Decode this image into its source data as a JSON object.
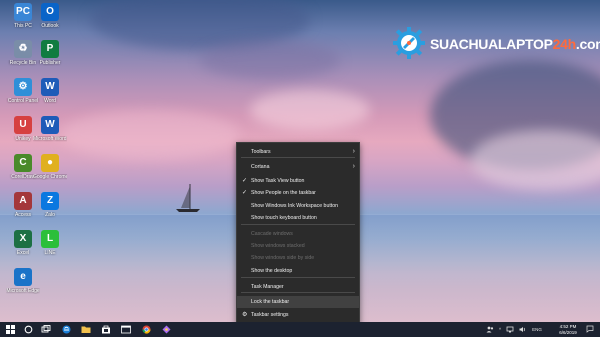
{
  "desktop": {
    "icons": [
      {
        "label": "This PC",
        "glyph": "PC",
        "color": "#3a86d6",
        "icon": "this-pc-icon"
      },
      {
        "label": "Outlook",
        "glyph": "O",
        "color": "#0a64c8",
        "icon": "outlook-icon"
      },
      {
        "label": "Recycle Bin",
        "glyph": "♻",
        "color": "#7a8da8",
        "icon": "recycle-bin-icon"
      },
      {
        "label": "Publisher",
        "glyph": "P",
        "color": "#107c41",
        "icon": "publisher-icon"
      },
      {
        "label": "Control Panel",
        "glyph": "⚙",
        "color": "#2f8fd8",
        "icon": "control-panel-icon"
      },
      {
        "label": "Word",
        "glyph": "W",
        "color": "#1e5bb8",
        "icon": "word-icon"
      },
      {
        "label": "Unikey",
        "glyph": "U",
        "color": "#d64040",
        "icon": "unikey-icon"
      },
      {
        "label": "Microsoft Word 2016",
        "glyph": "W",
        "color": "#1e5bb8",
        "icon": "word-2016-icon"
      },
      {
        "label": "CorelDraw",
        "glyph": "C",
        "color": "#4a8a2a",
        "icon": "coreldraw-icon"
      },
      {
        "label": "Google Chrome",
        "glyph": "●",
        "color": "#e0b020",
        "icon": "chrome-icon"
      },
      {
        "label": "Access",
        "glyph": "A",
        "color": "#a4373a",
        "icon": "access-icon"
      },
      {
        "label": "Zalo",
        "glyph": "Z",
        "color": "#0a78e0",
        "icon": "zalo-icon"
      },
      {
        "label": "Excel",
        "glyph": "X",
        "color": "#1d7044",
        "icon": "excel-icon"
      },
      {
        "label": "LINE",
        "glyph": "L",
        "color": "#2bbf3a",
        "icon": "line-icon"
      },
      {
        "label": "Microsoft Edge",
        "glyph": "e",
        "color": "#1a73c8",
        "icon": "edge-icon"
      }
    ]
  },
  "brand": {
    "name_main": "SUACHUALAPTOP",
    "name_num": "24h",
    "name_tail": ".com"
  },
  "menu": {
    "items": [
      {
        "label": "Toolbars",
        "submenu": true,
        "checked": false,
        "disabled": false
      },
      {
        "label": "Cortana",
        "submenu": true,
        "checked": false,
        "disabled": false
      },
      {
        "label": "Show Task View button",
        "checked": true,
        "disabled": false
      },
      {
        "label": "Show People on the taskbar",
        "checked": true,
        "disabled": false
      },
      {
        "label": "Show Windows Ink Workspace button",
        "checked": false,
        "disabled": false
      },
      {
        "label": "Show touch keyboard button",
        "checked": false,
        "disabled": false
      },
      {
        "label": "Cascade windows",
        "checked": false,
        "disabled": true
      },
      {
        "label": "Show windows stacked",
        "checked": false,
        "disabled": true
      },
      {
        "label": "Show windows side by side",
        "checked": false,
        "disabled": true
      },
      {
        "label": "Show the desktop",
        "checked": false,
        "disabled": false
      },
      {
        "label": "Task Manager",
        "checked": false,
        "disabled": false
      },
      {
        "label": "Lock the taskbar",
        "checked": false,
        "disabled": false,
        "highlighted": true
      },
      {
        "label": "Taskbar settings",
        "checked": false,
        "disabled": false,
        "gear": true
      }
    ]
  },
  "taskbar": {
    "pinned": [
      "start-icon",
      "search-icon",
      "task-view-icon",
      "edge-icon",
      "file-explorer-icon",
      "store-icon",
      "chrome-icon",
      "paint-icon"
    ],
    "tray_language": "ENG",
    "time": "4:52 PM",
    "date": "6/6/2019"
  }
}
